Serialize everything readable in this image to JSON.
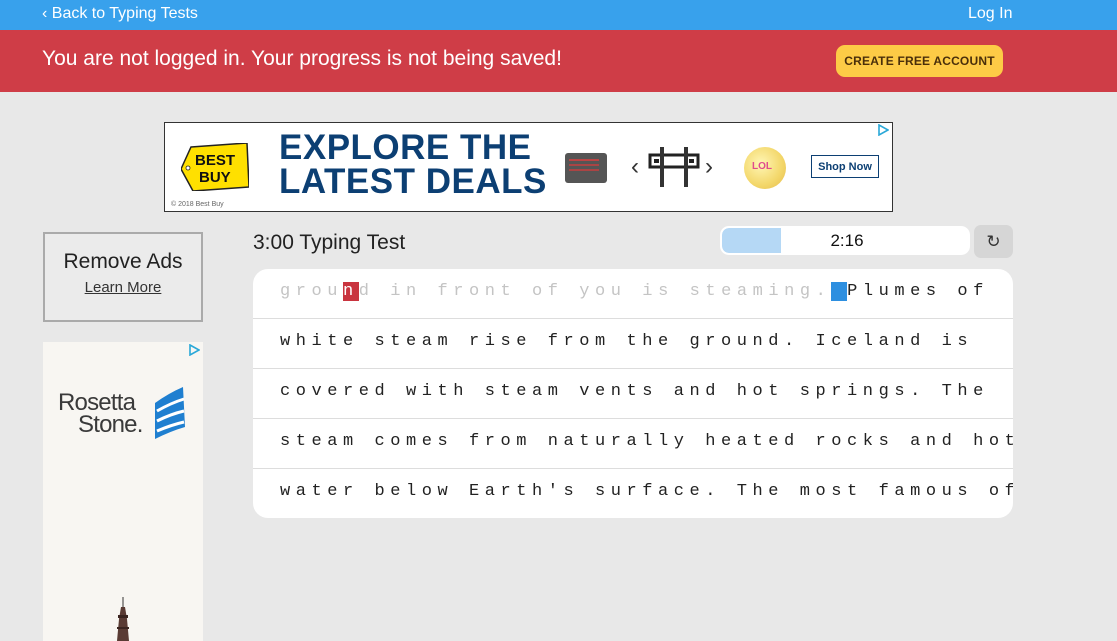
{
  "topbar": {
    "back_label": "‹ Back to Typing Tests",
    "login_label": "Log In"
  },
  "alert": {
    "message": "You are not logged in. Your progress is not being saved!",
    "cta_label": "CREATE FREE ACCOUNT",
    "bg_color": "#cf3d47",
    "cta_color": "#fdcb46"
  },
  "top_ad": {
    "brand": "BEST BUY",
    "headline_line1": "EXPLORE THE",
    "headline_line2": "LATEST DEALS",
    "copyright": "© 2018 Best Buy",
    "carousel_prev": "‹",
    "carousel_next": "›",
    "cta_label": "Shop Now",
    "adchoices_icon": "adchoices-icon"
  },
  "sidebar": {
    "remove_ads_title": "Remove Ads",
    "learn_more_label": "Learn More",
    "side_ad": {
      "brand_line1": "Rosetta",
      "brand_line2": "Stone."
    }
  },
  "test": {
    "title": "3:00 Typing Test",
    "timer_text": "2:16",
    "timer_progress_fraction": 0.24,
    "restart_icon": "↻",
    "lines": [
      {
        "segments": [
          {
            "kind": "typed",
            "text": "grou"
          },
          {
            "kind": "error",
            "text": "n"
          },
          {
            "kind": "typed",
            "text": "d in front of you is steaming."
          },
          {
            "kind": "cursor",
            "text": " "
          },
          {
            "kind": "pending",
            "text": "Plumes of"
          }
        ]
      },
      {
        "segments": [
          {
            "kind": "pending",
            "text": "white steam rise from the ground. Iceland is"
          }
        ]
      },
      {
        "segments": [
          {
            "kind": "pending",
            "text": "covered with steam vents and hot springs. The"
          }
        ]
      },
      {
        "segments": [
          {
            "kind": "pending",
            "text": "steam comes from naturally heated rocks and hot"
          }
        ]
      },
      {
        "segments": [
          {
            "kind": "pending",
            "text": "water below Earth's surface. The most famous of"
          }
        ]
      }
    ]
  }
}
